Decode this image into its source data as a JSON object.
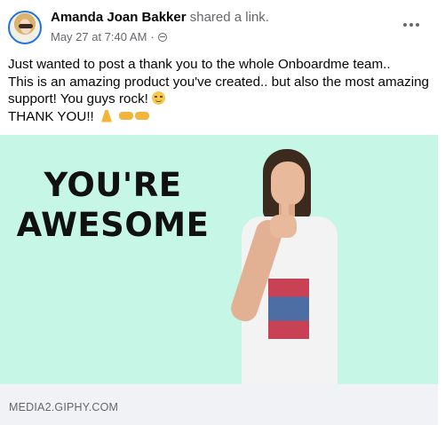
{
  "post": {
    "author": "Amanda Joan Bakker",
    "action": "shared a link.",
    "timestamp": "May 27 at 7:40 AM",
    "dot": "·",
    "privacy_icon": "globe-icon",
    "more_icon": "more-options-icon",
    "text_lines": [
      "Just wanted to post a thank you to the whole Onboardme team..",
      "This is an amazing product you've created.. but also the most amazing",
      "support! You guys rock!",
      "THANK YOU!!"
    ],
    "emojis": [
      "relieved-face-emoji",
      "folded-hands-emoji",
      "fist-bump-emoji"
    ]
  },
  "gif": {
    "caption_line1": "YOU'RE",
    "caption_line2": "AWESOME",
    "background_color": "#c5f6e6"
  },
  "link": {
    "domain": "MEDIA2.GIPHY.COM"
  },
  "colors": {
    "text": "#050505",
    "secondary_text": "#65676b",
    "accent": "#1b74e4",
    "link_bar": "#f0f2f5"
  }
}
